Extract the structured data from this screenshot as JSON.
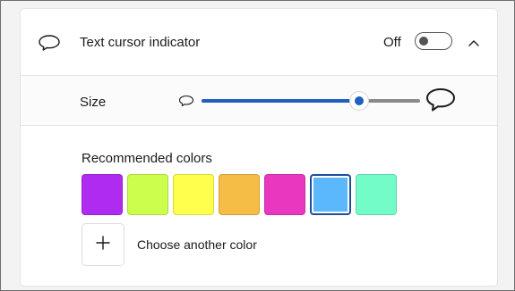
{
  "header": {
    "title": "Text cursor indicator",
    "toggle_state_label": "Off",
    "toggle_on": false,
    "icon": "speech-bubble-icon",
    "chevron_icon": "chevron-up-icon"
  },
  "size": {
    "label": "Size",
    "slider_value_fraction": 0.72,
    "small_icon": "speech-bubble-small-icon",
    "large_icon": "speech-bubble-large-icon"
  },
  "colors": {
    "label": "Recommended colors",
    "swatches": [
      {
        "color": "#b02bf0",
        "selected": false
      },
      {
        "color": "#ccff4d",
        "selected": false
      },
      {
        "color": "#ffff4d",
        "selected": false
      },
      {
        "color": "#f5bd45",
        "selected": false
      },
      {
        "color": "#ea37c0",
        "selected": false
      },
      {
        "color": "#5ab8fb",
        "selected": true
      },
      {
        "color": "#73fbc8",
        "selected": false
      }
    ],
    "add_icon": "plus-icon",
    "choose_label": "Choose another color"
  },
  "accent": "#1f5fbf"
}
